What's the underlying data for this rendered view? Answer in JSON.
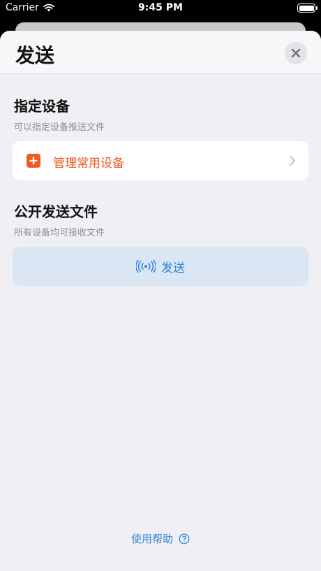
{
  "status_bar": {
    "carrier": "Carrier",
    "time": "9:45 PM"
  },
  "sheet": {
    "title": "发送"
  },
  "designated": {
    "title": "指定设备",
    "subtitle": "可以指定设备推送文件",
    "manage_label": "管理常用设备"
  },
  "public_send": {
    "title": "公开发送文件",
    "subtitle": "所有设备均可接收文件",
    "send_label": "发送"
  },
  "help": {
    "label": "使用帮助"
  },
  "colors": {
    "accent_orange": "#ef5a24",
    "accent_blue": "#2f84d8",
    "send_button_bg": "#dbe6f5"
  }
}
